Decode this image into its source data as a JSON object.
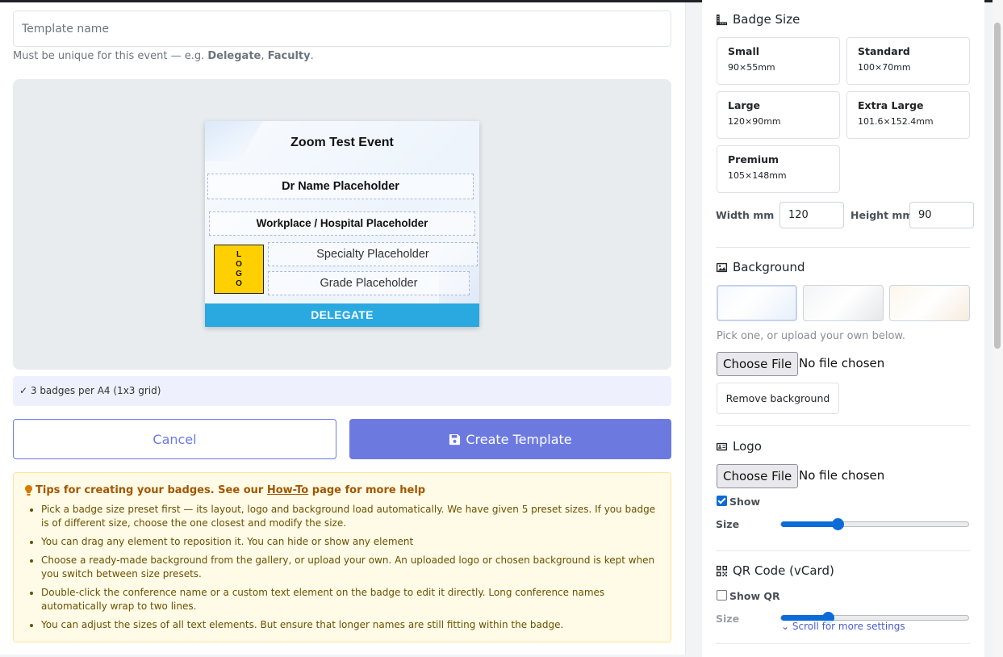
{
  "form": {
    "template_name_placeholder": "Template name",
    "hint_prefix": "Must be unique for this event — e.g. ",
    "hint_example1": "Delegate",
    "hint_sep": ", ",
    "hint_example2": "Faculty",
    "hint_suffix": "."
  },
  "badge": {
    "event_name": "Zoom Test Event",
    "name": "Dr Name Placeholder",
    "workplace": "Workplace / Hospital Placeholder",
    "specialty": "Specialty Placeholder",
    "grade": "Grade Placeholder",
    "logo_text": "LOGO",
    "ribbon": "DELEGATE",
    "ribbon_color": "#29a9e0",
    "logo_color": "#ffd000"
  },
  "fit_note": "✓ 3 badges per A4 (1x3 grid)",
  "actions": {
    "cancel": "Cancel",
    "create": "Create Template",
    "create_icon": "save-icon"
  },
  "tips": {
    "title_prefix": "Tips for creating your badges. See our ",
    "title_link": "How-To",
    "title_suffix": " page for more help",
    "items": [
      "Pick a badge size preset first — its layout, logo and background load automatically. We have given 5 preset sizes. If you badge is of different size, choose the one closest and modify the size.",
      "You can drag any element to reposition it. You can hide or show any element",
      "Choose a ready-made background from the gallery, or upload your own. An uploaded logo or chosen background is kept when you switch between size presets.",
      "Double-click the conference name or a custom text element on the badge to edit it directly. Long conference names automatically wrap to two lines.",
      "You can adjust the sizes of all text elements. But ensure that longer names are still fitting within the badge."
    ]
  },
  "sidebar": {
    "badge_size": {
      "title": "Badge Size",
      "presets": [
        {
          "name": "Small",
          "dims": "90×55mm"
        },
        {
          "name": "Standard",
          "dims": "100×70mm"
        },
        {
          "name": "Large",
          "dims": "120×90mm"
        },
        {
          "name": "Extra Large",
          "dims": "101.6×152.4mm"
        },
        {
          "name": "Premium",
          "dims": "105×148mm"
        }
      ],
      "width_label": "Width mm",
      "width_value": "120",
      "height_label": "Height mm",
      "height_value": "90"
    },
    "background": {
      "title": "Background",
      "hint": "Pick one, or upload your own below.",
      "choose_file": "Choose File",
      "no_file": "No file chosen",
      "remove": "Remove background"
    },
    "logo": {
      "title": "Logo",
      "choose_file": "Choose File",
      "no_file": "No file chosen",
      "show_label": "Show",
      "show_checked": true,
      "size_label": "Size",
      "size_level": 0.3
    },
    "qr": {
      "title": "QR Code (vCard)",
      "show_label": "Show QR",
      "show_checked": false,
      "size_label": "Size",
      "size_level": 0.25
    },
    "scroll_more": "Scroll for more settings"
  }
}
